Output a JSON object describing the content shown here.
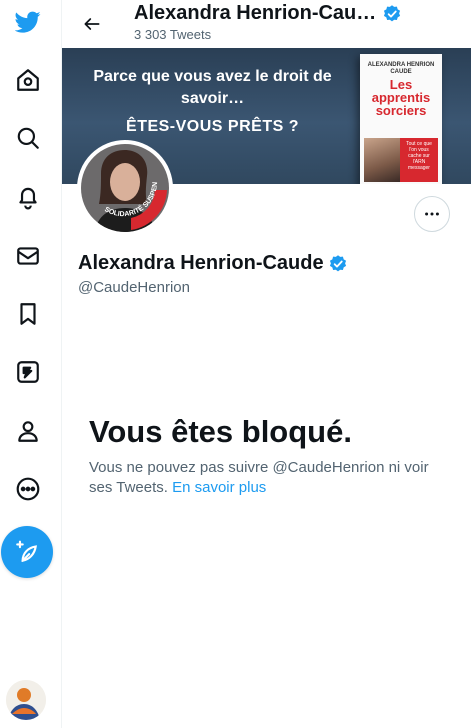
{
  "sidebar": {
    "items": [
      {
        "name": "twitter-logo-icon"
      },
      {
        "name": "home-icon"
      },
      {
        "name": "explore-icon"
      },
      {
        "name": "notifications-icon"
      },
      {
        "name": "messages-icon"
      },
      {
        "name": "bookmarks-icon"
      },
      {
        "name": "twitter-blue-icon"
      },
      {
        "name": "profile-icon"
      },
      {
        "name": "more-icon"
      },
      {
        "name": "compose-tweet-icon"
      }
    ]
  },
  "header": {
    "name": "Alexandra Henrion-Cau…",
    "tweet_count": "3 303 Tweets"
  },
  "banner": {
    "line1": "Parce que vous avez le droit de savoir…",
    "line2": "ÊTES-VOUS PRÊTS ?",
    "book_author": "ALEXANDRA HENRION CAUDE",
    "book_title": "Les apprentis sorciers",
    "book_tagline": "Tout ce que l'on vous cache sur l'ARN messager"
  },
  "profile": {
    "name": "Alexandra Henrion-Caude",
    "handle": "@CaudeHenrion",
    "badge_text": "SOLIDARITÉ SUSPENDUS"
  },
  "blocked": {
    "title": "Vous êtes bloqué.",
    "message": "Vous ne pouvez pas suivre @CaudeHenrion ni voir ses Tweets. ",
    "learn_more": "En savoir plus"
  },
  "colors": {
    "accent": "#1d9bf0",
    "text_primary": "#0f1419",
    "text_secondary": "#536471",
    "border": "#cfd9de"
  }
}
